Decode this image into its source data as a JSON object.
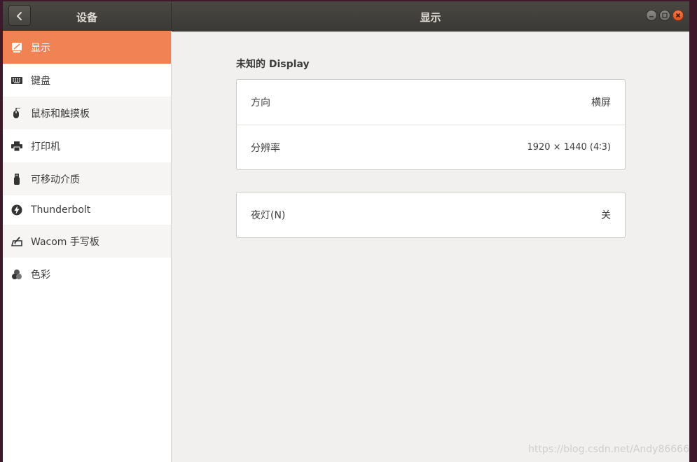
{
  "header": {
    "sidebar_title": "设备",
    "main_title": "显示"
  },
  "sidebar": {
    "items": [
      {
        "label": "显示",
        "icon": "display-icon"
      },
      {
        "label": "键盘",
        "icon": "keyboard-icon"
      },
      {
        "label": "鼠标和触摸板",
        "icon": "mouse-icon"
      },
      {
        "label": "打印机",
        "icon": "printer-icon"
      },
      {
        "label": "可移动介质",
        "icon": "usb-drive-icon"
      },
      {
        "label": "Thunderbolt",
        "icon": "thunderbolt-icon"
      },
      {
        "label": "Wacom 手写板",
        "icon": "tablet-icon"
      },
      {
        "label": "色彩",
        "icon": "color-icon"
      }
    ],
    "selected_index": 0
  },
  "main": {
    "section_title": "未知的 Display",
    "display_settings": [
      {
        "label": "方向",
        "value": "横屏"
      },
      {
        "label": "分辨率",
        "value": "1920 × 1440 (4∶3)"
      }
    ],
    "night_light": {
      "label": "夜灯(N)",
      "value": "关"
    }
  },
  "watermark": "https://blog.csdn.net/Andy86666",
  "colors": {
    "accent": "#f08254",
    "header_bg": "#3e3d39",
    "close_button": "#e95420"
  }
}
